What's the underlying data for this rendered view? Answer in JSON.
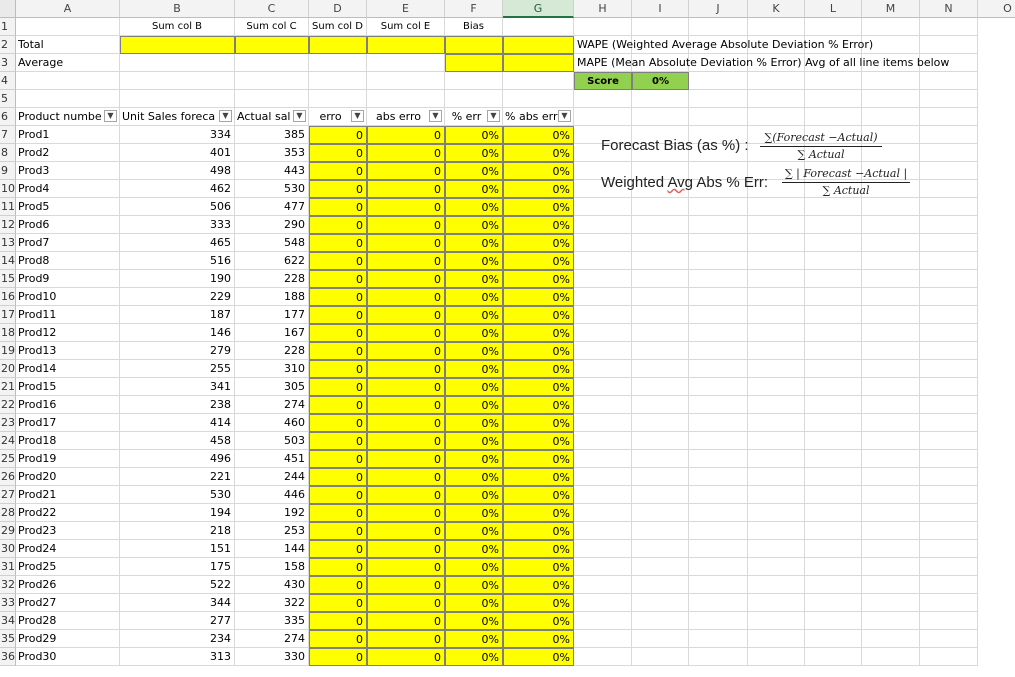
{
  "columns": [
    "A",
    "B",
    "C",
    "D",
    "E",
    "F",
    "G",
    "H",
    "I",
    "J",
    "K",
    "L",
    "M",
    "N",
    "O"
  ],
  "selected_column": "G",
  "row1": {
    "B": "Sum col B",
    "C": "Sum col C",
    "D": "Sum col D",
    "E": "Sum col E",
    "F": "Bias"
  },
  "row2": {
    "A": "Total",
    "H": "WAPE (Weighted Average Absolute Deviation % Error)"
  },
  "row3": {
    "A": "Average",
    "H": "MAPE (Mean Absolute Deviation % Error) Avg of all line items below"
  },
  "row4": {
    "score_label": "Score",
    "score_value": "0%"
  },
  "headers": {
    "A": "Product numbe",
    "B": "Unit Sales foreca",
    "C": "Actual sal",
    "D": "erro",
    "E": "abs erro",
    "F": "% err",
    "G": "% abs err"
  },
  "filter_icon": "filter-dropdown-icon",
  "products": [
    {
      "name": "Prod1",
      "forecast": "334",
      "actual": "385"
    },
    {
      "name": "Prod2",
      "forecast": "401",
      "actual": "353"
    },
    {
      "name": "Prod3",
      "forecast": "498",
      "actual": "443"
    },
    {
      "name": "Prod4",
      "forecast": "462",
      "actual": "530"
    },
    {
      "name": "Prod5",
      "forecast": "506",
      "actual": "477"
    },
    {
      "name": "Prod6",
      "forecast": "333",
      "actual": "290"
    },
    {
      "name": "Prod7",
      "forecast": "465",
      "actual": "548"
    },
    {
      "name": "Prod8",
      "forecast": "516",
      "actual": "622"
    },
    {
      "name": "Prod9",
      "forecast": "190",
      "actual": "228"
    },
    {
      "name": "Prod10",
      "forecast": "229",
      "actual": "188"
    },
    {
      "name": "Prod11",
      "forecast": "187",
      "actual": "177"
    },
    {
      "name": "Prod12",
      "forecast": "146",
      "actual": "167"
    },
    {
      "name": "Prod13",
      "forecast": "279",
      "actual": "228"
    },
    {
      "name": "Prod14",
      "forecast": "255",
      "actual": "310"
    },
    {
      "name": "Prod15",
      "forecast": "341",
      "actual": "305"
    },
    {
      "name": "Prod16",
      "forecast": "238",
      "actual": "274"
    },
    {
      "name": "Prod17",
      "forecast": "414",
      "actual": "460"
    },
    {
      "name": "Prod18",
      "forecast": "458",
      "actual": "503"
    },
    {
      "name": "Prod19",
      "forecast": "496",
      "actual": "451"
    },
    {
      "name": "Prod20",
      "forecast": "221",
      "actual": "244"
    },
    {
      "name": "Prod21",
      "forecast": "530",
      "actual": "446"
    },
    {
      "name": "Prod22",
      "forecast": "194",
      "actual": "192"
    },
    {
      "name": "Prod23",
      "forecast": "218",
      "actual": "253"
    },
    {
      "name": "Prod24",
      "forecast": "151",
      "actual": "144"
    },
    {
      "name": "Prod25",
      "forecast": "175",
      "actual": "158"
    },
    {
      "name": "Prod26",
      "forecast": "522",
      "actual": "430"
    },
    {
      "name": "Prod27",
      "forecast": "344",
      "actual": "322"
    },
    {
      "name": "Prod28",
      "forecast": "277",
      "actual": "335"
    },
    {
      "name": "Prod29",
      "forecast": "234",
      "actual": "274"
    },
    {
      "name": "Prod30",
      "forecast": "313",
      "actual": "330"
    }
  ],
  "calc_values": {
    "error": "0",
    "abs_error": "0",
    "pct_error": "0%",
    "pct_abs_error": "0%"
  },
  "formulas": {
    "bias_label": "Forecast Bias (as %) :",
    "bias_num": "∑(Forecast −Actual)",
    "bias_den": "∑ Actual",
    "wape_label_pre": "Weighted ",
    "wape_label_avg": "Avg",
    "wape_label_post": " Abs % Err:",
    "wape_num": "∑ | Forecast −Actual |",
    "wape_den": "∑ Actual"
  },
  "colors": {
    "highlight": "#ffff00",
    "score": "#92d050",
    "selected_header": "#217346"
  }
}
